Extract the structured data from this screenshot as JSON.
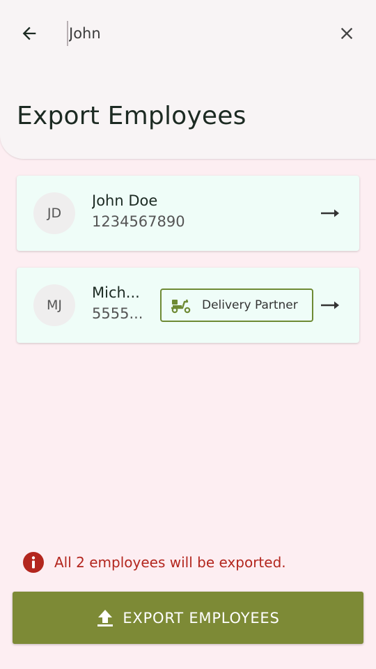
{
  "header": {
    "search_value": "John",
    "title": "Export Employees"
  },
  "icons": {
    "back": "arrow-left-icon",
    "clear": "close-icon",
    "row_arrow": "arrow-right-icon",
    "scooter": "scooter-icon",
    "info": "error-icon",
    "upload": "upload-icon"
  },
  "employees": [
    {
      "initials": "JD",
      "name": "John Doe",
      "phone": "1234567890"
    },
    {
      "initials": "MJ",
      "name": "Mich...",
      "phone": "5555...",
      "badge": "Delivery Partner"
    }
  ],
  "footer": {
    "notice": "All 2 employees will be exported.",
    "export_label": "EXPORT EMPLOYEES"
  },
  "colors": {
    "background": "#fdeef2",
    "card": "#effdf8",
    "accent": "#7d8a36",
    "error": "#b3261e"
  }
}
